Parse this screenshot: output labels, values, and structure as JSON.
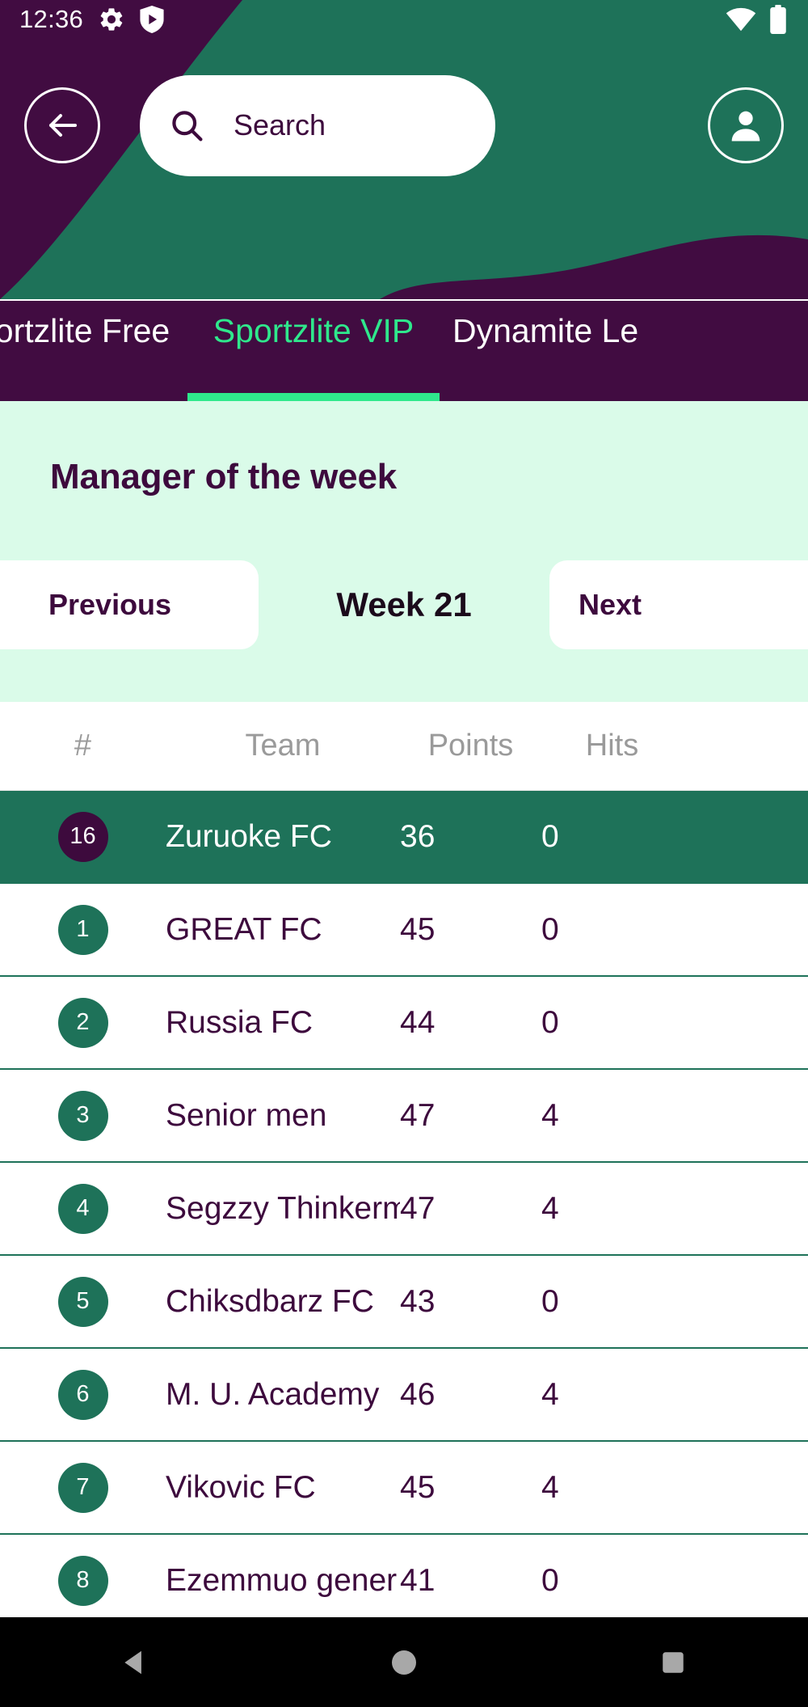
{
  "status_bar": {
    "time": "12:36",
    "left_icons": [
      "gear-icon",
      "play-shield-icon"
    ],
    "right_icons": [
      "wifi-icon",
      "battery-icon"
    ]
  },
  "header": {
    "back_button": "back-arrow-icon",
    "profile_button": "person-icon",
    "colors": {
      "purple": "#410c41",
      "teal": "#1e7259"
    }
  },
  "search": {
    "placeholder": "Search",
    "value": "",
    "icon": "search-icon"
  },
  "tabs": [
    {
      "label": "ortzlite Free",
      "active": false
    },
    {
      "label": "Sportzlite VIP",
      "active": true
    },
    {
      "label": "Dynamite Le",
      "active": false
    }
  ],
  "section": {
    "title": "Manager of the week",
    "accent": "#2fe88c",
    "background": "#dafbe9"
  },
  "week_nav": {
    "previous_label": "Previous",
    "previous_icon": "arrow-left-icon",
    "current": "Week 21",
    "next_label": "Next",
    "next_icon": "arrow-right-icon"
  },
  "table": {
    "headers": [
      "#",
      "Team",
      "Points",
      "Hits"
    ],
    "rows": [
      {
        "rank": "16",
        "team": "Zuruoke FC",
        "points": "36",
        "hits": "0",
        "highlight": true
      },
      {
        "rank": "1",
        "team": "GREAT FC",
        "points": "45",
        "hits": "0",
        "highlight": false
      },
      {
        "rank": "2",
        "team": "Russia FC",
        "points": "44",
        "hits": "0",
        "highlight": false
      },
      {
        "rank": "3",
        "team": "Senior men",
        "points": "47",
        "hits": "4",
        "highlight": false
      },
      {
        "rank": "4",
        "team": "Segzzy Thinkerm",
        "points": "47",
        "hits": "4",
        "highlight": false
      },
      {
        "rank": "5",
        "team": "Chiksdbarz FC",
        "points": "43",
        "hits": "0",
        "highlight": false
      },
      {
        "rank": "6",
        "team": "M. U. Academy",
        "points": "46",
        "hits": "4",
        "highlight": false
      },
      {
        "rank": "7",
        "team": "Vikovic FC",
        "points": "45",
        "hits": "4",
        "highlight": false
      },
      {
        "rank": "8",
        "team": "Ezemmuo gener",
        "points": "41",
        "hits": "0",
        "highlight": false
      }
    ]
  },
  "android_nav": {
    "back": "nav-back-icon",
    "home": "nav-home-icon",
    "recents": "nav-recents-icon"
  }
}
